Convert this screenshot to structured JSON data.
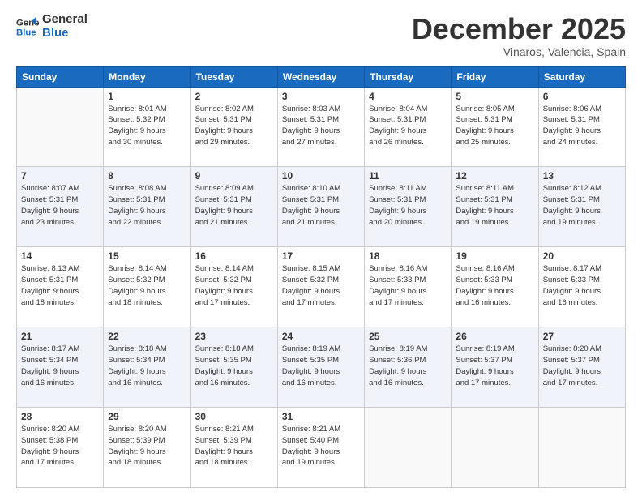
{
  "logo": {
    "line1": "General",
    "line2": "Blue"
  },
  "header": {
    "month": "December 2025",
    "location": "Vinaros, Valencia, Spain"
  },
  "days_of_week": [
    "Sunday",
    "Monday",
    "Tuesday",
    "Wednesday",
    "Thursday",
    "Friday",
    "Saturday"
  ],
  "weeks": [
    [
      {
        "num": "",
        "info": ""
      },
      {
        "num": "1",
        "info": "Sunrise: 8:01 AM\nSunset: 5:32 PM\nDaylight: 9 hours\nand 30 minutes."
      },
      {
        "num": "2",
        "info": "Sunrise: 8:02 AM\nSunset: 5:31 PM\nDaylight: 9 hours\nand 29 minutes."
      },
      {
        "num": "3",
        "info": "Sunrise: 8:03 AM\nSunset: 5:31 PM\nDaylight: 9 hours\nand 27 minutes."
      },
      {
        "num": "4",
        "info": "Sunrise: 8:04 AM\nSunset: 5:31 PM\nDaylight: 9 hours\nand 26 minutes."
      },
      {
        "num": "5",
        "info": "Sunrise: 8:05 AM\nSunset: 5:31 PM\nDaylight: 9 hours\nand 25 minutes."
      },
      {
        "num": "6",
        "info": "Sunrise: 8:06 AM\nSunset: 5:31 PM\nDaylight: 9 hours\nand 24 minutes."
      }
    ],
    [
      {
        "num": "7",
        "info": "Sunrise: 8:07 AM\nSunset: 5:31 PM\nDaylight: 9 hours\nand 23 minutes."
      },
      {
        "num": "8",
        "info": "Sunrise: 8:08 AM\nSunset: 5:31 PM\nDaylight: 9 hours\nand 22 minutes."
      },
      {
        "num": "9",
        "info": "Sunrise: 8:09 AM\nSunset: 5:31 PM\nDaylight: 9 hours\nand 21 minutes."
      },
      {
        "num": "10",
        "info": "Sunrise: 8:10 AM\nSunset: 5:31 PM\nDaylight: 9 hours\nand 21 minutes."
      },
      {
        "num": "11",
        "info": "Sunrise: 8:11 AM\nSunset: 5:31 PM\nDaylight: 9 hours\nand 20 minutes."
      },
      {
        "num": "12",
        "info": "Sunrise: 8:11 AM\nSunset: 5:31 PM\nDaylight: 9 hours\nand 19 minutes."
      },
      {
        "num": "13",
        "info": "Sunrise: 8:12 AM\nSunset: 5:31 PM\nDaylight: 9 hours\nand 19 minutes."
      }
    ],
    [
      {
        "num": "14",
        "info": "Sunrise: 8:13 AM\nSunset: 5:31 PM\nDaylight: 9 hours\nand 18 minutes."
      },
      {
        "num": "15",
        "info": "Sunrise: 8:14 AM\nSunset: 5:32 PM\nDaylight: 9 hours\nand 18 minutes."
      },
      {
        "num": "16",
        "info": "Sunrise: 8:14 AM\nSunset: 5:32 PM\nDaylight: 9 hours\nand 17 minutes."
      },
      {
        "num": "17",
        "info": "Sunrise: 8:15 AM\nSunset: 5:32 PM\nDaylight: 9 hours\nand 17 minutes."
      },
      {
        "num": "18",
        "info": "Sunrise: 8:16 AM\nSunset: 5:33 PM\nDaylight: 9 hours\nand 17 minutes."
      },
      {
        "num": "19",
        "info": "Sunrise: 8:16 AM\nSunset: 5:33 PM\nDaylight: 9 hours\nand 16 minutes."
      },
      {
        "num": "20",
        "info": "Sunrise: 8:17 AM\nSunset: 5:33 PM\nDaylight: 9 hours\nand 16 minutes."
      }
    ],
    [
      {
        "num": "21",
        "info": "Sunrise: 8:17 AM\nSunset: 5:34 PM\nDaylight: 9 hours\nand 16 minutes."
      },
      {
        "num": "22",
        "info": "Sunrise: 8:18 AM\nSunset: 5:34 PM\nDaylight: 9 hours\nand 16 minutes."
      },
      {
        "num": "23",
        "info": "Sunrise: 8:18 AM\nSunset: 5:35 PM\nDaylight: 9 hours\nand 16 minutes."
      },
      {
        "num": "24",
        "info": "Sunrise: 8:19 AM\nSunset: 5:35 PM\nDaylight: 9 hours\nand 16 minutes."
      },
      {
        "num": "25",
        "info": "Sunrise: 8:19 AM\nSunset: 5:36 PM\nDaylight: 9 hours\nand 16 minutes."
      },
      {
        "num": "26",
        "info": "Sunrise: 8:19 AM\nSunset: 5:37 PM\nDaylight: 9 hours\nand 17 minutes."
      },
      {
        "num": "27",
        "info": "Sunrise: 8:20 AM\nSunset: 5:37 PM\nDaylight: 9 hours\nand 17 minutes."
      }
    ],
    [
      {
        "num": "28",
        "info": "Sunrise: 8:20 AM\nSunset: 5:38 PM\nDaylight: 9 hours\nand 17 minutes."
      },
      {
        "num": "29",
        "info": "Sunrise: 8:20 AM\nSunset: 5:39 PM\nDaylight: 9 hours\nand 18 minutes."
      },
      {
        "num": "30",
        "info": "Sunrise: 8:21 AM\nSunset: 5:39 PM\nDaylight: 9 hours\nand 18 minutes."
      },
      {
        "num": "31",
        "info": "Sunrise: 8:21 AM\nSunset: 5:40 PM\nDaylight: 9 hours\nand 19 minutes."
      },
      {
        "num": "",
        "info": ""
      },
      {
        "num": "",
        "info": ""
      },
      {
        "num": "",
        "info": ""
      }
    ]
  ]
}
